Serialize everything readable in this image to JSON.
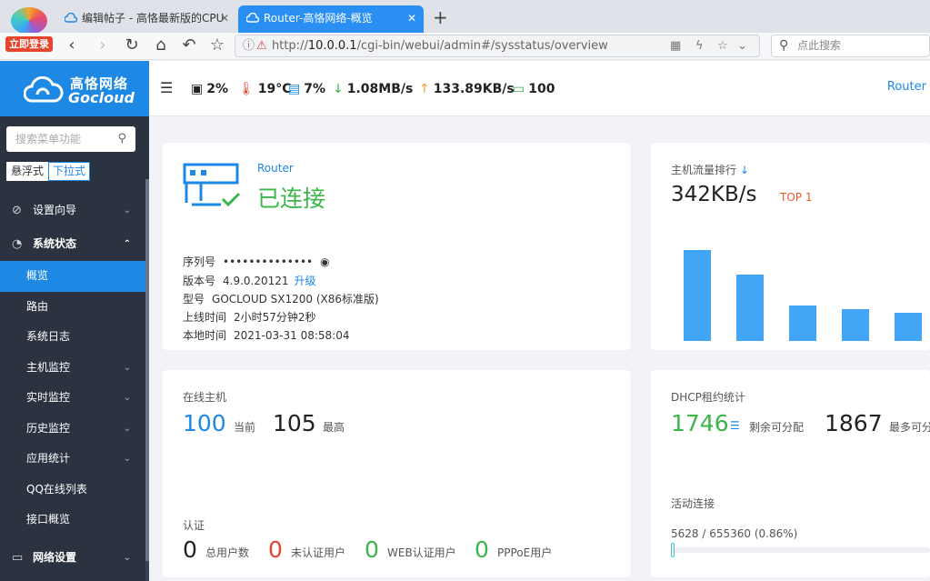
{
  "browser": {
    "login_badge": "立即登录",
    "tabs": [
      {
        "label": "编辑帖子 - 高恪最新版的CPU"
      },
      {
        "label": "Router-高恪网络-概览"
      }
    ],
    "url_prefix": "http://",
    "url_host": "10.0.0.1",
    "url_path": "/cgi-bin/webui/admin#/sysstatus/overview",
    "search_placeholder": "点此搜索"
  },
  "brand": {
    "name_cn": "高恪网络",
    "name_en": "Gocloud"
  },
  "sidebar": {
    "search_placeholder": "搜索菜单功能",
    "mode_float": "悬浮式",
    "mode_dropdown": "下拉式",
    "items": [
      {
        "label": "设置向导",
        "icon": "compass-icon"
      },
      {
        "label": "系统状态",
        "icon": "gauge-icon"
      }
    ],
    "sub_items": [
      {
        "label": "概览"
      },
      {
        "label": "路由"
      },
      {
        "label": "系统日志"
      },
      {
        "label": "主机监控"
      },
      {
        "label": "实时监控"
      },
      {
        "label": "历史监控"
      },
      {
        "label": "应用统计"
      },
      {
        "label": "QQ在线列表"
      },
      {
        "label": "接口概览"
      }
    ],
    "bottom_item": {
      "label": "网络设置",
      "icon": "monitor-icon"
    }
  },
  "topbar": {
    "cpu": "2%",
    "temperature": "19°C",
    "memory": "7%",
    "download": "1.08MB/s",
    "upload": "133.89KB/s",
    "hosts": "100",
    "router_link": "Router"
  },
  "router_card": {
    "name": "Router",
    "status": "已连接",
    "serial_label": "序列号",
    "serial_value": "••••••••••••••",
    "version_label": "版本号",
    "version_value": "4.9.0.20121",
    "upgrade_link": "升级",
    "model_label": "型号",
    "model_value": "GOCLOUD SX1200 (X86标准版)",
    "uptime_label": "上线时间",
    "uptime_value": "2小时57分钟2秒",
    "localtime_label": "本地时间",
    "localtime_value": "2021-03-31 08:58:04"
  },
  "traffic_card": {
    "title": "主机流量排行",
    "rate": "342KB/s",
    "top_label": "TOP 1"
  },
  "chart_data": {
    "type": "bar",
    "series": [
      {
        "values": [
          100,
          73,
          39,
          35,
          31
        ]
      }
    ],
    "color": "#42a5f5"
  },
  "hosts_card": {
    "title": "在线主机",
    "current_value": "100",
    "current_label": "当前",
    "max_value": "105",
    "max_label": "最高",
    "auth_title": "认证",
    "total_users": "0",
    "total_users_label": "总用户数",
    "unauth_users": "0",
    "unauth_users_label": "未认证用户",
    "web_users": "0",
    "web_users_label": "WEB认证用户",
    "pppoe_users": "0",
    "pppoe_users_label": "PPPoE用户"
  },
  "dhcp_card": {
    "title": "DHCP租约统计",
    "remaining_value": "1746",
    "remaining_label": "剩余可分配",
    "max_value": "1867",
    "max_label": "最多可分",
    "conn_title": "活动连接",
    "conn_text": "5628 / 655360 (0.86%)",
    "conn_fraction": 0.0086
  },
  "colors": {
    "accent": "#1e88e5",
    "success": "#3cb54a",
    "danger": "#e8442d",
    "sidebar": "#2b3340"
  }
}
